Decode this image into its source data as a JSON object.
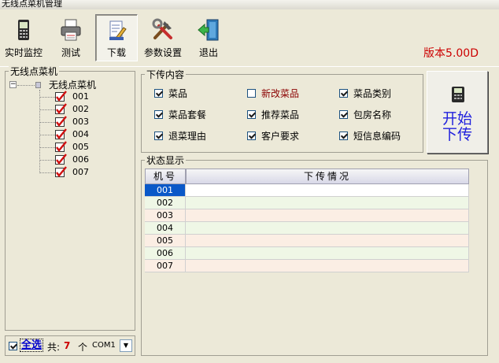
{
  "window": {
    "title": "无线点菜机管理"
  },
  "toolbar": {
    "buttons": [
      {
        "label": "实时监控",
        "icon": "pda-terminal-icon"
      },
      {
        "label": "测试",
        "icon": "printer-icon"
      },
      {
        "label": "下载",
        "icon": "document-edit-icon",
        "active": true
      },
      {
        "label": "参数设置",
        "icon": "tools-icon"
      },
      {
        "label": "退出",
        "icon": "exit-door-icon"
      }
    ],
    "version": "版本5.00D"
  },
  "left_panel": {
    "title": "无线点菜机",
    "tree": {
      "root": "无线点菜机",
      "items": [
        "001",
        "002",
        "003",
        "004",
        "005",
        "006",
        "007"
      ]
    },
    "select_all_label": "全选",
    "count_prefix": "共:",
    "count_value": "7",
    "count_unit": "个",
    "port_value": "COM1"
  },
  "download_content": {
    "title": "下传内容",
    "options": [
      {
        "label": "菜品",
        "checked": true
      },
      {
        "label": "新改菜品",
        "checked": false
      },
      {
        "label": "菜品类别",
        "checked": true
      },
      {
        "label": "菜品套餐",
        "checked": true
      },
      {
        "label": "推荐菜品",
        "checked": true
      },
      {
        "label": "包房名称",
        "checked": true
      },
      {
        "label": "退菜理由",
        "checked": true
      },
      {
        "label": "客户要求",
        "checked": true
      },
      {
        "label": "短信息编码",
        "checked": true
      }
    ]
  },
  "start_button": {
    "line1": "开始",
    "line2": "下传"
  },
  "status": {
    "title": "状态显示",
    "columns": [
      "机号",
      "下传情况"
    ],
    "rows": [
      {
        "id": "001",
        "info": ""
      },
      {
        "id": "002",
        "info": ""
      },
      {
        "id": "003",
        "info": ""
      },
      {
        "id": "004",
        "info": ""
      },
      {
        "id": "005",
        "info": ""
      },
      {
        "id": "006",
        "info": ""
      },
      {
        "id": "007",
        "info": ""
      }
    ]
  },
  "colors": {
    "accent_red": "#cc0000",
    "start_blue": "#1f1fdd",
    "row_peach": "#fbeee4",
    "row_green": "#eff7e6",
    "selected_cell": "#0a58c8"
  }
}
